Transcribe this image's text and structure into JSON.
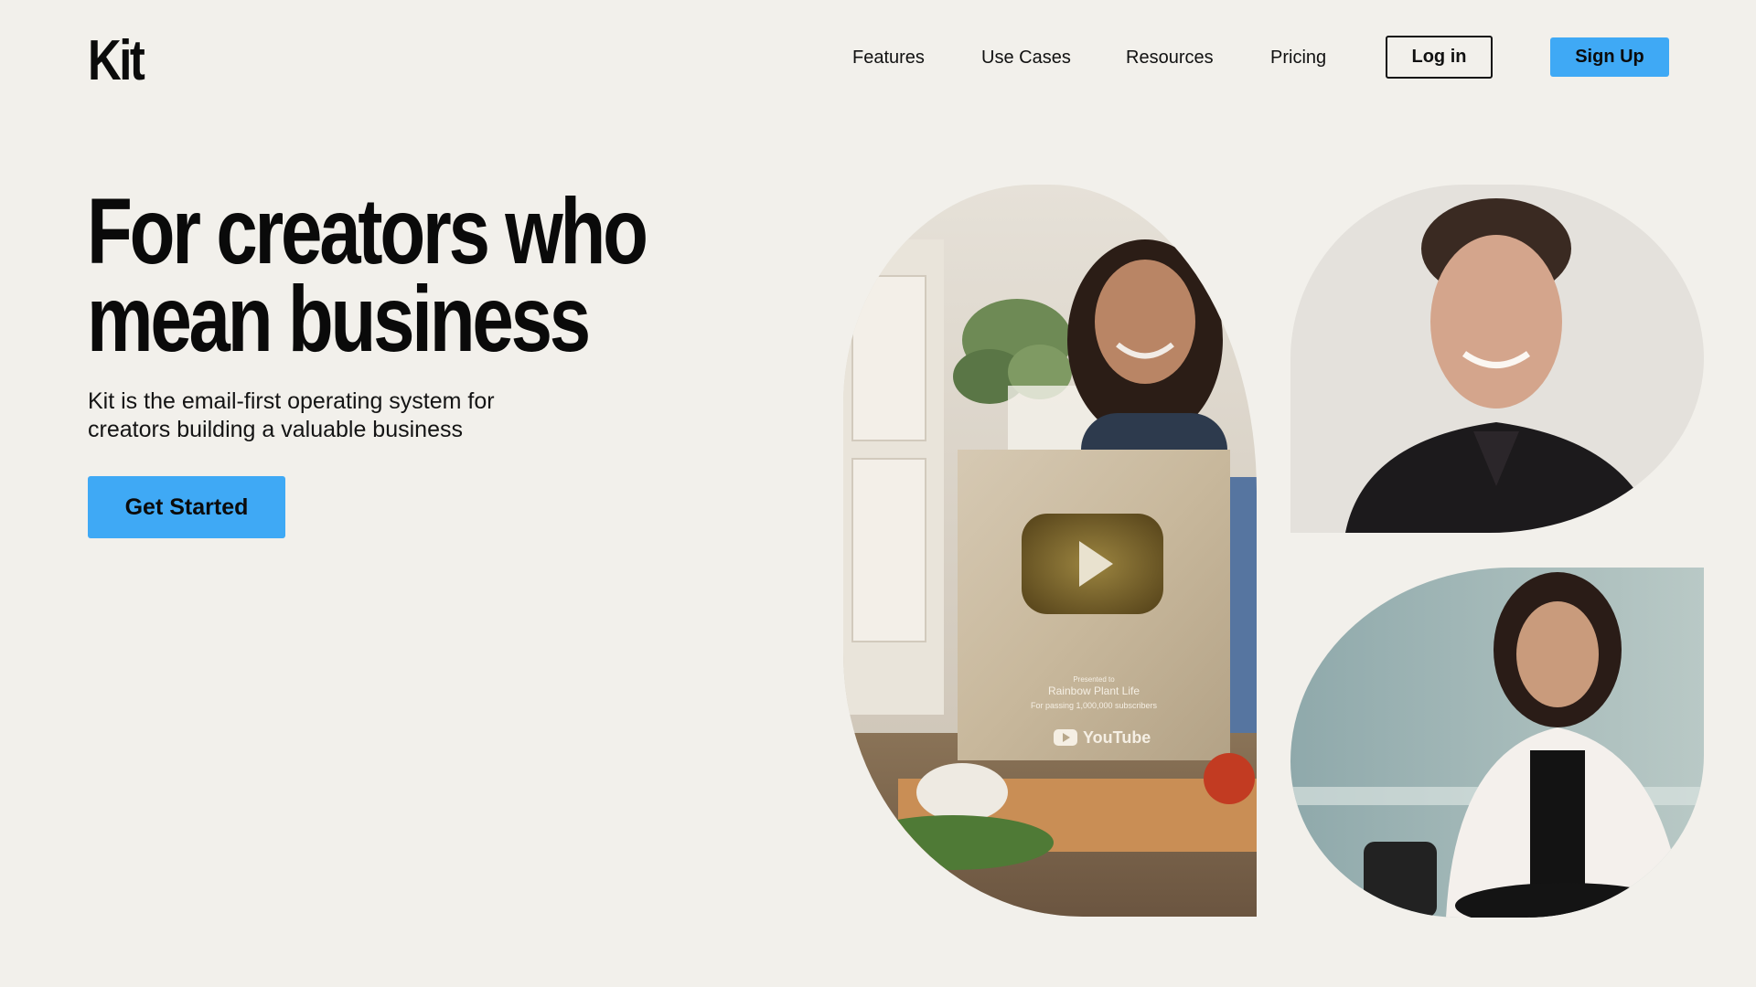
{
  "brand": {
    "logo_text": "Kit"
  },
  "nav": {
    "links": [
      "Features",
      "Use Cases",
      "Resources",
      "Pricing"
    ],
    "login_label": "Log in",
    "signup_label": "Sign Up"
  },
  "hero": {
    "title_line1": "For creators who",
    "title_line2": "mean business",
    "subtitle_line1": "Kit is the email-first operating system for",
    "subtitle_line2": "creators building a valuable business",
    "cta_label": "Get Started"
  },
  "plaque": {
    "presented_to": "Presented to",
    "channel": "Rainbow Plant Life",
    "milestone": "For passing 1,000,000 subscribers",
    "brand": "YouTube"
  },
  "colors": {
    "background": "#f2f0eb",
    "accent": "#3fa9f5",
    "text": "#0c0c0c"
  }
}
